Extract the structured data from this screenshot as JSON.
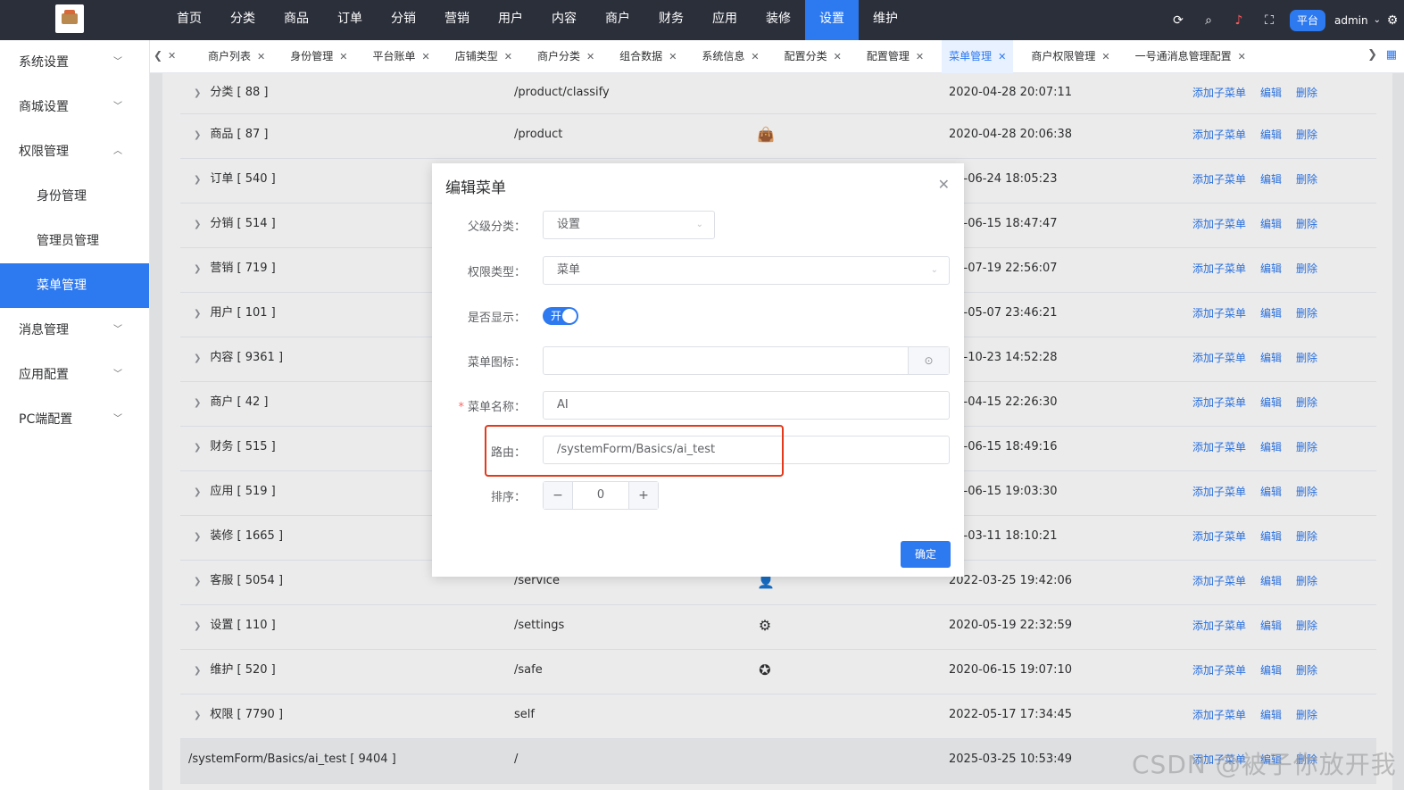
{
  "topnav": {
    "items": [
      "首页",
      "分类",
      "商品",
      "订单",
      "分销",
      "营销",
      "用户",
      "内容",
      "商户",
      "财务",
      "应用",
      "装修",
      "设置",
      "维护"
    ],
    "active_index": 12
  },
  "topright": {
    "platform": "平台",
    "user": "admin",
    "icons": [
      "refresh-icon",
      "search-icon",
      "bell-icon",
      "fullscreen-icon"
    ]
  },
  "sidebar": {
    "items": [
      {
        "label": "系统设置",
        "level": 1,
        "chev": "down"
      },
      {
        "label": "商城设置",
        "level": 1,
        "chev": "down"
      },
      {
        "label": "权限管理",
        "level": 1,
        "chev": "up"
      },
      {
        "label": "身份管理",
        "level": 2
      },
      {
        "label": "管理员管理",
        "level": 2
      },
      {
        "label": "菜单管理",
        "level": 2,
        "active": true
      },
      {
        "label": "消息管理",
        "level": 1,
        "chev": "down"
      },
      {
        "label": "应用配置",
        "level": 1,
        "chev": "down"
      },
      {
        "label": "PC端配置",
        "level": 1,
        "chev": "down"
      }
    ]
  },
  "tabs": [
    "商户列表",
    "身份管理",
    "平台账单",
    "店铺类型",
    "商户分类",
    "组合数据",
    "系统信息",
    "配置分类",
    "配置管理",
    "菜单管理",
    "商户权限管理",
    "一号通消息管理配置"
  ],
  "active_tab": "菜单管理",
  "table": {
    "ops": [
      "添加子菜单",
      "编辑",
      "删除"
    ],
    "rows": [
      {
        "name": "分类 [ 88 ]",
        "path": "/product/classify",
        "icon": "",
        "time": "2020-04-28 20:07:11"
      },
      {
        "name": "商品 [ 87 ]",
        "path": "/product",
        "icon": "bag",
        "time": "2020-04-28 20:06:38"
      },
      {
        "name": "订单 [ 540 ]",
        "path": "",
        "icon": "",
        "time": "20-06-24 18:05:23"
      },
      {
        "name": "分销 [ 514 ]",
        "path": "",
        "icon": "",
        "time": "20-06-15 18:47:47"
      },
      {
        "name": "营销 [ 719 ]",
        "path": "",
        "icon": "",
        "time": "20-07-19 22:56:07"
      },
      {
        "name": "用户 [ 101 ]",
        "path": "",
        "icon": "",
        "time": "20-05-07 23:46:21"
      },
      {
        "name": "内容 [ 9361 ]",
        "path": "",
        "icon": "",
        "time": "24-10-23 14:52:28"
      },
      {
        "name": "商户 [ 42 ]",
        "path": "",
        "icon": "",
        "time": "20-04-15 22:26:30"
      },
      {
        "name": "财务 [ 515 ]",
        "path": "",
        "icon": "",
        "time": "20-06-15 18:49:16"
      },
      {
        "name": "应用 [ 519 ]",
        "path": "",
        "icon": "",
        "time": "20-06-15 19:03:30"
      },
      {
        "name": "装修 [ 1665 ]",
        "path": "",
        "icon": "",
        "time": "22-03-11 18:10:21"
      },
      {
        "name": "客服 [ 5054 ]",
        "path": "/service",
        "icon": "person",
        "time": "2022-03-25 19:42:06"
      },
      {
        "name": "设置 [ 110 ]",
        "path": "/settings",
        "icon": "gear",
        "time": "2020-05-19 22:32:59"
      },
      {
        "name": "维护 [ 520 ]",
        "path": "/safe",
        "icon": "aperture",
        "time": "2020-06-15 19:07:10"
      },
      {
        "name": "权限 [ 7790 ]",
        "path": "self",
        "icon": "",
        "time": "2022-05-17 17:34:45"
      },
      {
        "name": "/systemForm/Basics/ai_test [ 9404 ]",
        "path": "/",
        "icon": "",
        "time": "2025-03-25 10:53:49",
        "highlight": true,
        "no_arrow": true
      }
    ]
  },
  "dialog": {
    "title": "编辑菜单",
    "fields": {
      "parent": {
        "label": "父级分类：",
        "value": "设置"
      },
      "type": {
        "label": "权限类型：",
        "value": "菜单"
      },
      "show": {
        "label": "是否显示：",
        "toggle_text": "开",
        "on": true
      },
      "icon": {
        "label": "菜单图标：",
        "value": ""
      },
      "name": {
        "label": "菜单名称：",
        "required_mark": "*",
        "value": "AI"
      },
      "route": {
        "label": "路由：",
        "value": "/systemForm/Basics/ai_test"
      },
      "sort": {
        "label": "排序：",
        "value": "0",
        "minus": "−",
        "plus": "+"
      }
    },
    "confirm": "确定"
  },
  "watermark": "CSDN @被子你放开我"
}
